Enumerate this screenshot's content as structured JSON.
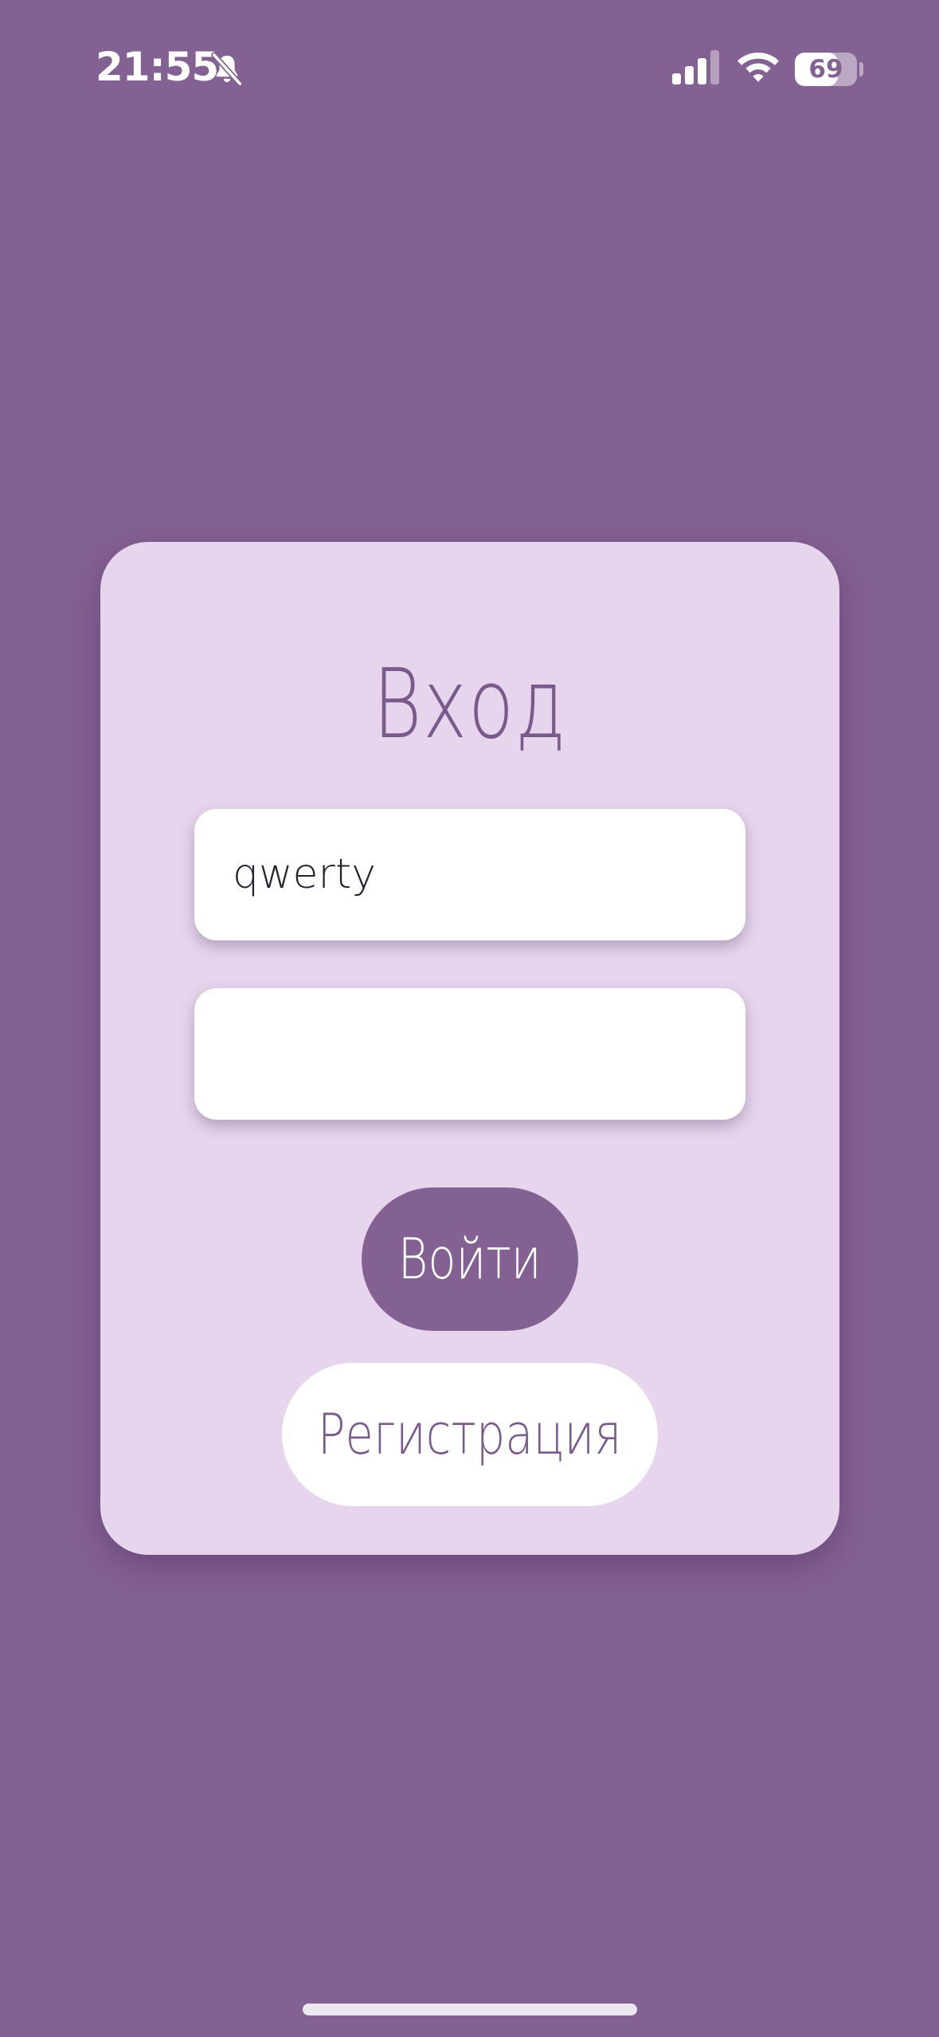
{
  "status_bar": {
    "time": "21:55",
    "battery_level": "69",
    "battery_fraction": 0.69,
    "icons": [
      "bell-slash-icon",
      "cellular-signal-icon",
      "wifi-icon",
      "battery-icon"
    ]
  },
  "login_card": {
    "title": "Вход",
    "login_field": {
      "value": "qwerty",
      "placeholder": ""
    },
    "password_field": {
      "value": "",
      "placeholder": ""
    },
    "login_button": "Войти",
    "register_button": "Регистрация"
  },
  "colors": {
    "background": "#846193",
    "card": "#e6d5ec",
    "accent": "#846193",
    "title_text": "#7a5a8c",
    "field": "#ffffff"
  }
}
